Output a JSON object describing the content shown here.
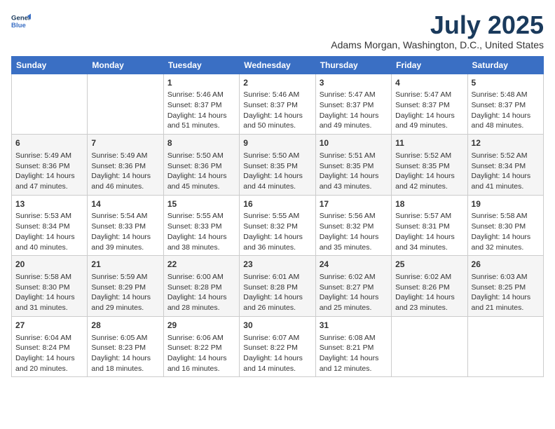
{
  "logo": {
    "line1": "General",
    "line2": "Blue"
  },
  "title": "July 2025",
  "subtitle": "Adams Morgan, Washington, D.C., United States",
  "days_of_week": [
    "Sunday",
    "Monday",
    "Tuesday",
    "Wednesday",
    "Thursday",
    "Friday",
    "Saturday"
  ],
  "weeks": [
    [
      {
        "day": "",
        "info": ""
      },
      {
        "day": "",
        "info": ""
      },
      {
        "day": "1",
        "info": "Sunrise: 5:46 AM\nSunset: 8:37 PM\nDaylight: 14 hours and 51 minutes."
      },
      {
        "day": "2",
        "info": "Sunrise: 5:46 AM\nSunset: 8:37 PM\nDaylight: 14 hours and 50 minutes."
      },
      {
        "day": "3",
        "info": "Sunrise: 5:47 AM\nSunset: 8:37 PM\nDaylight: 14 hours and 49 minutes."
      },
      {
        "day": "4",
        "info": "Sunrise: 5:47 AM\nSunset: 8:37 PM\nDaylight: 14 hours and 49 minutes."
      },
      {
        "day": "5",
        "info": "Sunrise: 5:48 AM\nSunset: 8:37 PM\nDaylight: 14 hours and 48 minutes."
      }
    ],
    [
      {
        "day": "6",
        "info": "Sunrise: 5:49 AM\nSunset: 8:36 PM\nDaylight: 14 hours and 47 minutes."
      },
      {
        "day": "7",
        "info": "Sunrise: 5:49 AM\nSunset: 8:36 PM\nDaylight: 14 hours and 46 minutes."
      },
      {
        "day": "8",
        "info": "Sunrise: 5:50 AM\nSunset: 8:36 PM\nDaylight: 14 hours and 45 minutes."
      },
      {
        "day": "9",
        "info": "Sunrise: 5:50 AM\nSunset: 8:35 PM\nDaylight: 14 hours and 44 minutes."
      },
      {
        "day": "10",
        "info": "Sunrise: 5:51 AM\nSunset: 8:35 PM\nDaylight: 14 hours and 43 minutes."
      },
      {
        "day": "11",
        "info": "Sunrise: 5:52 AM\nSunset: 8:35 PM\nDaylight: 14 hours and 42 minutes."
      },
      {
        "day": "12",
        "info": "Sunrise: 5:52 AM\nSunset: 8:34 PM\nDaylight: 14 hours and 41 minutes."
      }
    ],
    [
      {
        "day": "13",
        "info": "Sunrise: 5:53 AM\nSunset: 8:34 PM\nDaylight: 14 hours and 40 minutes."
      },
      {
        "day": "14",
        "info": "Sunrise: 5:54 AM\nSunset: 8:33 PM\nDaylight: 14 hours and 39 minutes."
      },
      {
        "day": "15",
        "info": "Sunrise: 5:55 AM\nSunset: 8:33 PM\nDaylight: 14 hours and 38 minutes."
      },
      {
        "day": "16",
        "info": "Sunrise: 5:55 AM\nSunset: 8:32 PM\nDaylight: 14 hours and 36 minutes."
      },
      {
        "day": "17",
        "info": "Sunrise: 5:56 AM\nSunset: 8:32 PM\nDaylight: 14 hours and 35 minutes."
      },
      {
        "day": "18",
        "info": "Sunrise: 5:57 AM\nSunset: 8:31 PM\nDaylight: 14 hours and 34 minutes."
      },
      {
        "day": "19",
        "info": "Sunrise: 5:58 AM\nSunset: 8:30 PM\nDaylight: 14 hours and 32 minutes."
      }
    ],
    [
      {
        "day": "20",
        "info": "Sunrise: 5:58 AM\nSunset: 8:30 PM\nDaylight: 14 hours and 31 minutes."
      },
      {
        "day": "21",
        "info": "Sunrise: 5:59 AM\nSunset: 8:29 PM\nDaylight: 14 hours and 29 minutes."
      },
      {
        "day": "22",
        "info": "Sunrise: 6:00 AM\nSunset: 8:28 PM\nDaylight: 14 hours and 28 minutes."
      },
      {
        "day": "23",
        "info": "Sunrise: 6:01 AM\nSunset: 8:28 PM\nDaylight: 14 hours and 26 minutes."
      },
      {
        "day": "24",
        "info": "Sunrise: 6:02 AM\nSunset: 8:27 PM\nDaylight: 14 hours and 25 minutes."
      },
      {
        "day": "25",
        "info": "Sunrise: 6:02 AM\nSunset: 8:26 PM\nDaylight: 14 hours and 23 minutes."
      },
      {
        "day": "26",
        "info": "Sunrise: 6:03 AM\nSunset: 8:25 PM\nDaylight: 14 hours and 21 minutes."
      }
    ],
    [
      {
        "day": "27",
        "info": "Sunrise: 6:04 AM\nSunset: 8:24 PM\nDaylight: 14 hours and 20 minutes."
      },
      {
        "day": "28",
        "info": "Sunrise: 6:05 AM\nSunset: 8:23 PM\nDaylight: 14 hours and 18 minutes."
      },
      {
        "day": "29",
        "info": "Sunrise: 6:06 AM\nSunset: 8:22 PM\nDaylight: 14 hours and 16 minutes."
      },
      {
        "day": "30",
        "info": "Sunrise: 6:07 AM\nSunset: 8:22 PM\nDaylight: 14 hours and 14 minutes."
      },
      {
        "day": "31",
        "info": "Sunrise: 6:08 AM\nSunset: 8:21 PM\nDaylight: 14 hours and 12 minutes."
      },
      {
        "day": "",
        "info": ""
      },
      {
        "day": "",
        "info": ""
      }
    ]
  ]
}
